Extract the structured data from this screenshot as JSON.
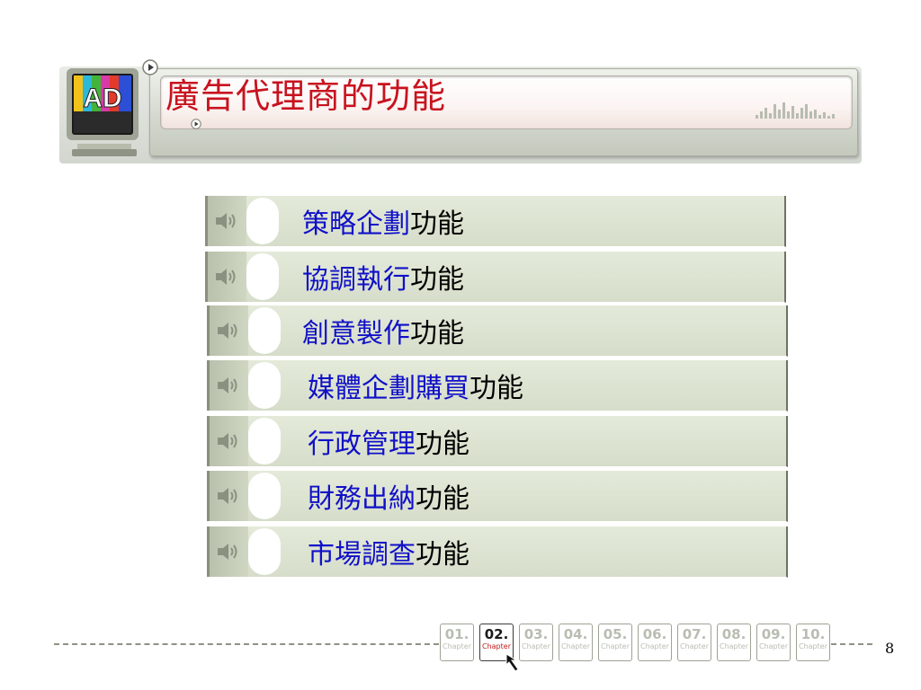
{
  "slide": {
    "title": "廣告代理商的功能",
    "logo_text": "AD",
    "page_number": "8"
  },
  "colors": {
    "title": "#c8131f",
    "highlight": "#1010c8",
    "row_bg": "#dce2d0",
    "nav_inactive": "#b9bdb1",
    "nav_active_word": "#c21a1a"
  },
  "functions": [
    {
      "highlight": "策略企劃",
      "rest": "功能",
      "icon": "speaker-icon"
    },
    {
      "highlight": "協調執行",
      "rest": "功能",
      "icon": "speaker-icon"
    },
    {
      "highlight": "創意製作",
      "rest": "功能",
      "icon": "speaker-icon"
    },
    {
      "highlight": "媒體企劃購買",
      "rest": "功能",
      "icon": "speaker-icon"
    },
    {
      "highlight": "行政管理",
      "rest": "功能",
      "icon": "speaker-icon"
    },
    {
      "highlight": "財務出納",
      "rest": "功能",
      "icon": "speaker-icon"
    },
    {
      "highlight": "市場調查",
      "rest": "功能",
      "icon": "speaker-icon"
    }
  ],
  "chapters": {
    "label": "Chapter",
    "active": "02.",
    "items": [
      "01.",
      "02.",
      "03.",
      "04.",
      "05.",
      "06.",
      "07.",
      "08.",
      "09.",
      "10."
    ]
  }
}
